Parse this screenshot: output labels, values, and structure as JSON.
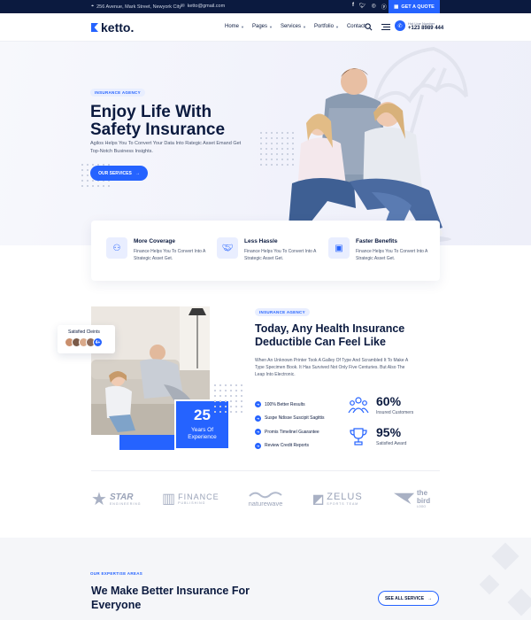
{
  "topbar": {
    "address": "256 Avenue, Mark Street, Newyork City",
    "email": "ketto@gmail.com",
    "social": [
      "f",
      "t",
      "ig",
      "p"
    ],
    "quote_button": "GET A QUOTE"
  },
  "header": {
    "logo": "ketto.",
    "nav": [
      {
        "label": "Home",
        "dropdown": true
      },
      {
        "label": "Pages",
        "dropdown": true
      },
      {
        "label": "Services",
        "dropdown": true
      },
      {
        "label": "Portfolio",
        "dropdown": true
      },
      {
        "label": "Contact",
        "dropdown": false
      }
    ],
    "hotline_label": "Hot Line Number",
    "hotline_number": "+123 8989 444"
  },
  "hero": {
    "badge": "INSURANCE AGENCY",
    "title": "Enjoy Life With Safety Insurance",
    "description": "Agilos Helps You To Convert Your Data Into Rategic Asset Emand Get Top-Notch Business Insights.",
    "button": "OUR SERVICES"
  },
  "features": [
    {
      "title": "More Coverage",
      "desc": "Finance Helps You To Convert Into A Strategic Asset Get.",
      "icon": "coverage-icon"
    },
    {
      "title": "Less Hassle",
      "desc": "Finance Helps You To Convert Into A Strategic Asset Get.",
      "icon": "handshake-icon"
    },
    {
      "title": "Faster Benefits",
      "desc": "Finance Helps You To Convert Into A Strategic Asset Get.",
      "icon": "wallet-icon"
    }
  ],
  "about": {
    "satisfied_label": "Satisfied Cleints",
    "avatar_more": "4+",
    "years_number": "25",
    "years_label": "Years Of Experience",
    "badge": "INSURANCE AGENCY",
    "title": "Today, Any Health Insurance Deductible Can Feel Like",
    "description": "When An Unknown Printer Took A Galley Of Type And Scrambled It To Make A Type Specimen Book. It Has Survived Not Only Five Centuries. But Also The Leap Into Electronic.",
    "checks": [
      "100% Better Results",
      "Suspe Ndisse Suscipit Sagittis",
      "Promis Timelinel Guarantee",
      "Review Credit Reports"
    ],
    "stats": [
      {
        "value": "60%",
        "label": "Insured Customers",
        "icon": "customers-icon"
      },
      {
        "value": "95%",
        "label": "Satisfied Award",
        "icon": "trophy-icon"
      }
    ]
  },
  "brands": [
    {
      "name": "STAR",
      "sub": "ENGINEERING"
    },
    {
      "name": "FINANCE",
      "sub": "PUBLISHING"
    },
    {
      "name": "naturewave",
      "sub": ""
    },
    {
      "name": "ZELUS",
      "sub": "SPORTS TEAM"
    },
    {
      "name": "the bird",
      "sub": "LOGO"
    }
  ],
  "services": {
    "badge": "OUR EXPERTISE AREAS",
    "title": "We Make Better Insurance For Everyone",
    "button": "SEE ALL SERVICE"
  },
  "colors": {
    "primary": "#2563ff",
    "navy": "#0b1a3f",
    "muted": "#4a5670"
  }
}
